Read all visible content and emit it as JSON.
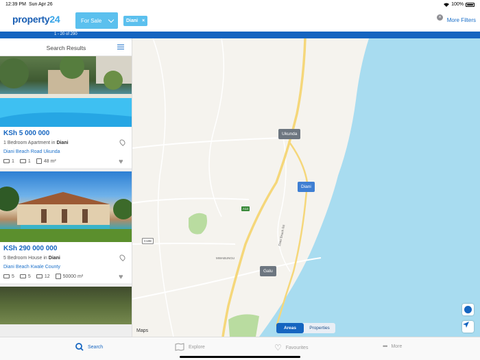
{
  "status": {
    "time": "12:39 PM",
    "date": "Sun Apr 26",
    "battery": "100%"
  },
  "header": {
    "logo_main": "property",
    "logo_num": "24",
    "sale_label": "For Sale",
    "filter_chip": "Diani",
    "chip_close": "×",
    "clear_icon": "×",
    "more_filters": "More Filters"
  },
  "results": {
    "range": "1 - 20 of 290"
  },
  "list": {
    "title": "Search Results",
    "cards": [
      {
        "price": "KSh 5 000 000",
        "desc_prefix": "1 Bedroom Apartment in ",
        "desc_town": "Diani",
        "location": "Diani Beach Road Ukunda",
        "beds": "1",
        "baths": "1",
        "size": "48 m²"
      },
      {
        "price": "KSh 290 000 000",
        "desc_prefix": "5 Bedroom House in ",
        "desc_town": "Diani",
        "location": "Diani Beach Kwale County",
        "beds": "5",
        "baths": "5",
        "garages": "12",
        "size": "50000 m²"
      }
    ]
  },
  "map": {
    "markers": {
      "ukunda": "Ukunda",
      "diani": "Diani",
      "galu": "Galu"
    },
    "road_labels": {
      "mwabungu": "MWABUNGU",
      "diani_beach_rd": "Diani Beach Rd",
      "c108": "C108",
      "a14": "A14"
    },
    "toggle": {
      "areas": "Areas",
      "properties": "Properties"
    },
    "attribution": "Maps",
    "colors": {
      "sea": "#a8dcf0",
      "land": "#f5f3ee",
      "road": "#f5d77a",
      "park": "#b9dca0"
    }
  },
  "tabbar": {
    "items": [
      {
        "label": "Search",
        "icon": "search-icon"
      },
      {
        "label": "Explore",
        "icon": "map-icon"
      },
      {
        "label": "Favourites",
        "icon": "heart-icon"
      },
      {
        "label": "More",
        "icon": "more-icon"
      }
    ]
  },
  "colors": {
    "brand": "#1565c0",
    "accent": "#5bc0ee",
    "link": "#1a6fc9"
  }
}
